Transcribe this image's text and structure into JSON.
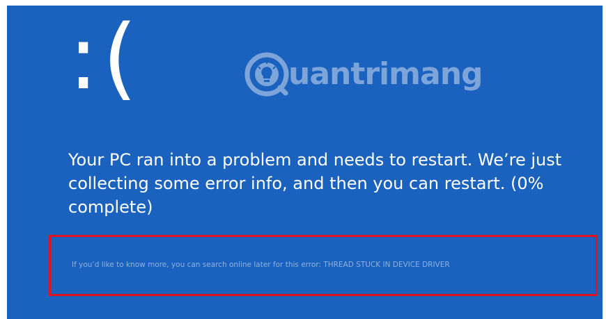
{
  "screen": {
    "background_color": "#1a62be",
    "sad_face": ":(",
    "watermark": {
      "icon": "lightbulb-logo-icon",
      "text": "uantrimang"
    },
    "message": "Your PC ran into a problem and needs to restart. We’re just collecting some error info, and then you can restart. (0% complete)",
    "progress_percent": 0,
    "info_text": "If you’d like to know more, you can search online later for this error: THREAD STUCK IN DEVICE DRIVER",
    "highlight_color": "#e2131f"
  }
}
